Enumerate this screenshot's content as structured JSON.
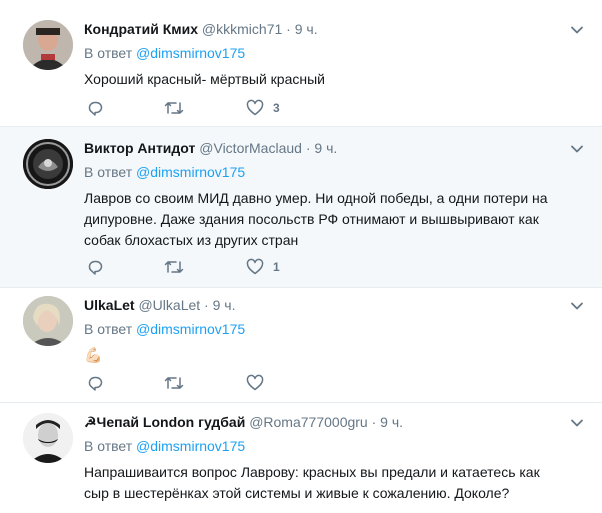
{
  "tweets": [
    {
      "fullname": "Кондратий Кмих",
      "username": "@kkkmich71",
      "separator": "·",
      "time": "9 ч.",
      "reply_prefix": "В ответ",
      "reply_handle": "@dimsmirnov175",
      "text": "Хороший красный- мёртвый красный",
      "like_count": "3"
    },
    {
      "fullname": "Виктор Антидот",
      "username": "@VictorMaclaud",
      "separator": "·",
      "time": "9 ч.",
      "reply_prefix": "В ответ",
      "reply_handle": "@dimsmirnov175",
      "text": "Лавров со своим МИД давно умер. Ни одной победы, а одни потери на дипуровне. Даже здания посольств РФ отнимают и вышвыривают как собак блохастых из других стран",
      "like_count": "1"
    },
    {
      "fullname": "UlkaLet",
      "username": "@UlkaLet",
      "separator": "·",
      "time": "9 ч.",
      "reply_prefix": "В ответ",
      "reply_handle": "@dimsmirnov175",
      "text": "💪🏻",
      "like_count": ""
    },
    {
      "fullname": "☭Чепай London гудбай",
      "username": "@Roma777000gru",
      "separator": "·",
      "time": "9 ч.",
      "reply_prefix": "В ответ",
      "reply_handle": "@dimsmirnov175",
      "text": "Напрашиваится вопрос Лаврову: красных вы предали и катаетесь как сыр в шестерёнках этой системы и живые к сожалению. Доколе?",
      "like_count": ""
    }
  ],
  "icons": {
    "reply": "reply-icon",
    "retweet": "retweet-icon",
    "like": "heart-icon",
    "more": "chevron-down-icon"
  },
  "colors": {
    "link": "#1da1f2",
    "secondary": "#657786",
    "highlight_bg": "#f5f8fa",
    "border": "#e6ecf0"
  }
}
